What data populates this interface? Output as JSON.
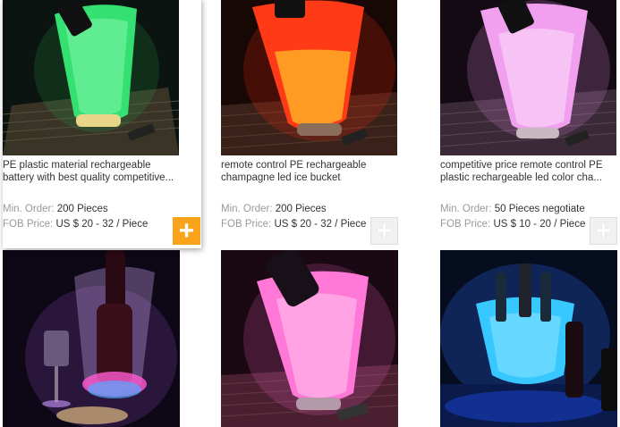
{
  "products": [
    {
      "title": "PE plastic material rechargeable battery with best quality competitive...",
      "min_order_label": "Min. Order:",
      "min_order_value": "200 Pieces",
      "fob_label": "FOB Price:",
      "fob_value": "US $ 20 - 32 / Piece",
      "glow_color": "#2fe06a",
      "bg_color": "#0b1410"
    },
    {
      "title": "remote control PE rechargeable champagne led ice bucket",
      "min_order_label": "Min. Order:",
      "min_order_value": "200 Pieces",
      "fob_label": "FOB Price:",
      "fob_value": "US $ 20 - 32 / Piece",
      "glow_color": "#ff3a1a",
      "bg_color": "#170806"
    },
    {
      "title": "competitive price remote control PE plastic rechargeable led color cha...",
      "min_order_label": "Min. Order:",
      "min_order_value": "50 Pieces negotiate",
      "fob_label": "FOB Price:",
      "fob_value": "US $ 10 - 20 / Piece",
      "glow_color": "#f2a8f0",
      "bg_color": "#140a14"
    },
    {
      "glow_color": "#c777e8",
      "bg_color": "#0d0716"
    },
    {
      "glow_color": "#ff7ad9",
      "bg_color": "#1a0812"
    },
    {
      "glow_color": "#35c8ff",
      "bg_color": "#060d1f"
    }
  ],
  "add_icon_glyph": "+"
}
